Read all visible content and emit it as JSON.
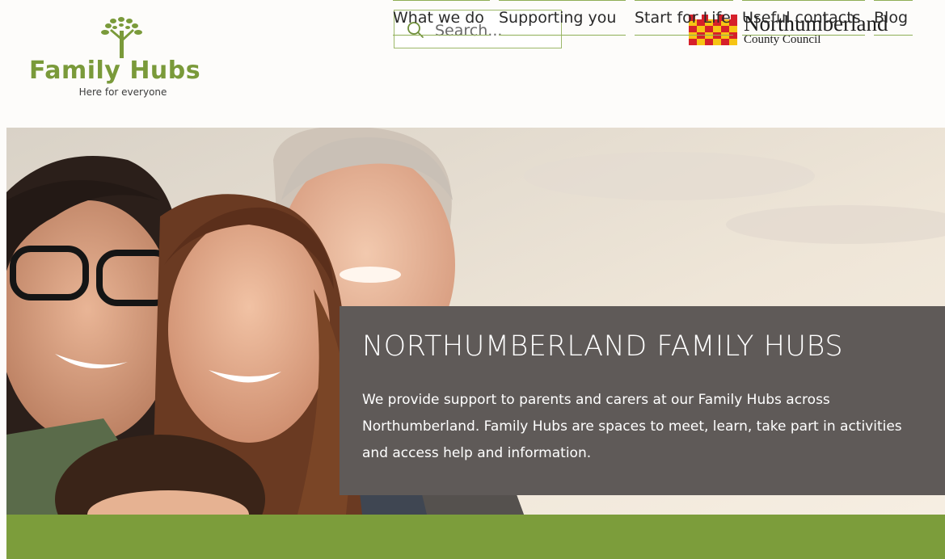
{
  "header": {
    "logo": {
      "word_family": "Family",
      "word_hubs": "Hubs",
      "tagline": "Here for everyone",
      "color": "#7a9a3a"
    },
    "search": {
      "placeholder": "Search...",
      "value": "",
      "icon": "search-icon",
      "border_color": "#9db86a"
    },
    "council": {
      "name": "Northumberland",
      "subtitle": "County Council",
      "crest_colors": [
        "#d6202a",
        "#f6c414"
      ]
    },
    "nav": [
      {
        "label": "What we do"
      },
      {
        "label": "Supporting you"
      },
      {
        "label": "Start for Life"
      },
      {
        "label": "Useful contacts"
      },
      {
        "label": "Blog"
      }
    ],
    "nav_rule_color": "#8fae56"
  },
  "hero": {
    "title": "NORTHUMBERLAND FAMILY HUBS",
    "text": "We provide support to parents and carers at our Family Hubs across Northumberland. Family Hubs are spaces to meet, learn, take part in activities and access help and information.",
    "panel_color": "#5f5a58"
  },
  "band": {
    "color": "#7c9d3b"
  }
}
